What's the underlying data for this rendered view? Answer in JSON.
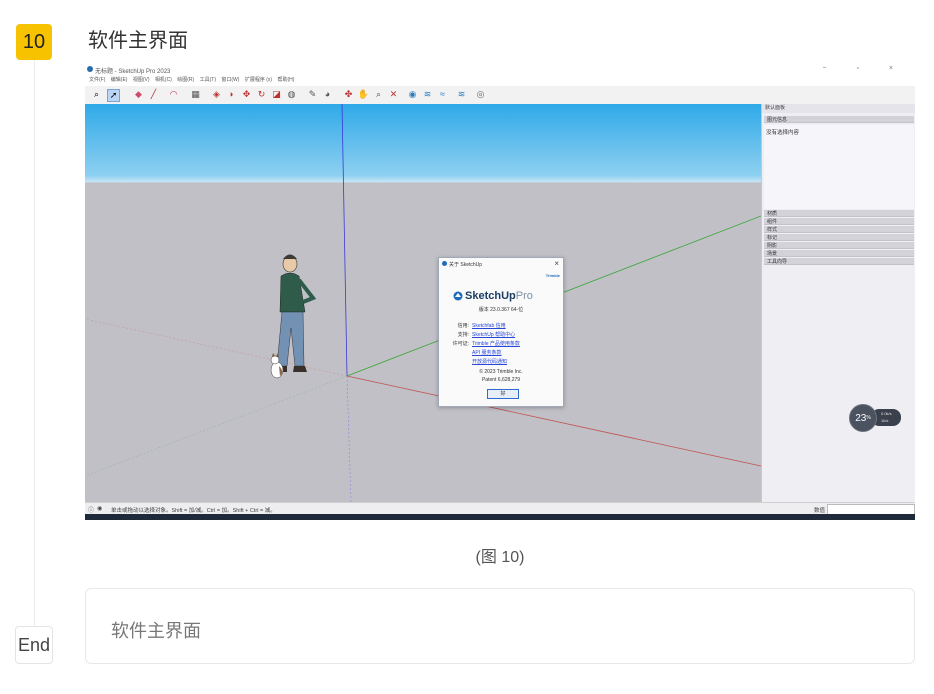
{
  "step": {
    "number": "10",
    "title": "软件主界面"
  },
  "caption": "(图 10)",
  "end_label": "End",
  "note_text": "软件主界面",
  "window": {
    "title": "无标题 - SketchUp Pro 2023",
    "controls": [
      "−",
      "▫",
      "×"
    ],
    "menu": [
      "文件(F)",
      "编辑(E)",
      "视图(V)",
      "相机(C)",
      "绘图(R)",
      "工具(T)",
      "窗口(W)",
      "扩展程序 (x)",
      "帮助(H)"
    ]
  },
  "panel": {
    "header": "默认面板",
    "entity_info": "图元信息",
    "empty_selection": "没有选择内容",
    "sections": [
      "材质",
      "组件",
      "样式",
      "标记",
      "阴影",
      "场景",
      "工具向导"
    ]
  },
  "status": {
    "message": "单击或拖动以选择对象。Shift = 加/减。Ctrl = 加。Shift + Ctrl = 减。",
    "measure_label": "数值"
  },
  "dialog": {
    "title": "关于 SketchUp",
    "trimble": "Trimble",
    "brand_main": "SketchUp",
    "brand_sub": "Pro",
    "version": "版本 23.0.367 64-位",
    "rows": [
      {
        "label": "信用:",
        "link": "Sketchfab 信用"
      },
      {
        "label": "支持:",
        "link": "SketchUp 帮助中心"
      },
      {
        "label": "许可证:",
        "link": "Trimble 产品使用条款"
      },
      {
        "label": "",
        "link": "API 服务条款"
      },
      {
        "label": "",
        "link": "开放源代码通知"
      }
    ],
    "copyright": "© 2023 Trimble Inc.",
    "patent": "Patent 6,628,279",
    "ok": "好"
  },
  "overlay": {
    "value": "23",
    "unit": "%",
    "up": "0.0k/s",
    "down": "1k/s"
  },
  "colors": {
    "badge": "#f7c300",
    "sky": "#2fa9e8",
    "ground": "#c0c0c6",
    "x_axis": "#c0504d",
    "y_axis": "#3aa537",
    "z_axis": "#3a3ad8"
  }
}
